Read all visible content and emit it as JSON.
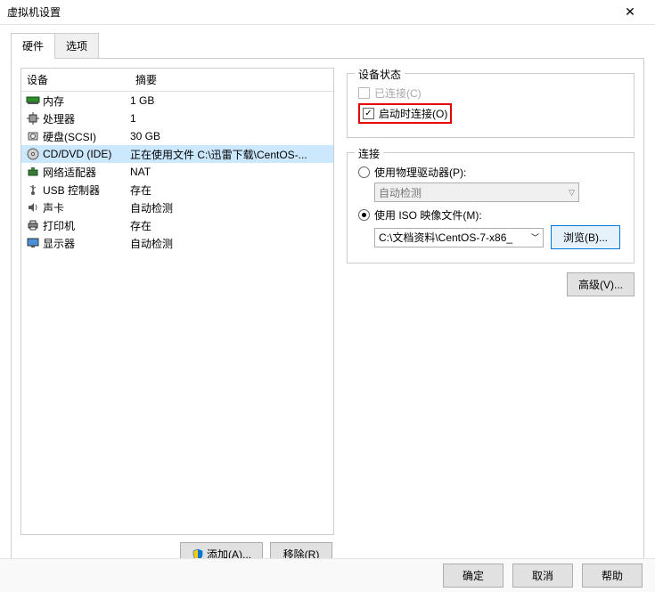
{
  "window": {
    "title": "虚拟机设置"
  },
  "tabs": {
    "hardware": "硬件",
    "options": "选项"
  },
  "listHead": {
    "name": "设备",
    "summary": "摘要"
  },
  "devices": [
    {
      "key": "memory",
      "name": "内存",
      "summary": "1 GB"
    },
    {
      "key": "cpu",
      "name": "处理器",
      "summary": "1"
    },
    {
      "key": "hdd",
      "name": "硬盘(SCSI)",
      "summary": "30 GB"
    },
    {
      "key": "cd",
      "name": "CD/DVD (IDE)",
      "summary": "正在使用文件 C:\\迅雷下载\\CentOS-..."
    },
    {
      "key": "net",
      "name": "网络适配器",
      "summary": "NAT"
    },
    {
      "key": "usb",
      "name": "USB 控制器",
      "summary": "存在"
    },
    {
      "key": "sound",
      "name": "声卡",
      "summary": "自动检测"
    },
    {
      "key": "printer",
      "name": "打印机",
      "summary": "存在"
    },
    {
      "key": "display",
      "name": "显示器",
      "summary": "自动检测"
    }
  ],
  "leftButtons": {
    "add": "添加(A)...",
    "remove": "移除(R)"
  },
  "status": {
    "title": "设备状态",
    "connected": "已连接(C)",
    "connectedChecked": false,
    "connectOnStart": "启动时连接(O)",
    "connectOnStartChecked": true
  },
  "connection": {
    "title": "连接",
    "usePhysical": "使用物理驱动器(P):",
    "physicalCombo": "自动检测",
    "useIso": "使用 ISO 映像文件(M):",
    "isoPath": "C:\\文档资料\\CentOS-7-x86_",
    "browse": "浏览(B)...",
    "selected": "iso"
  },
  "advanced": "高级(V)...",
  "footer": {
    "ok": "确定",
    "cancel": "取消",
    "help": "帮助"
  }
}
